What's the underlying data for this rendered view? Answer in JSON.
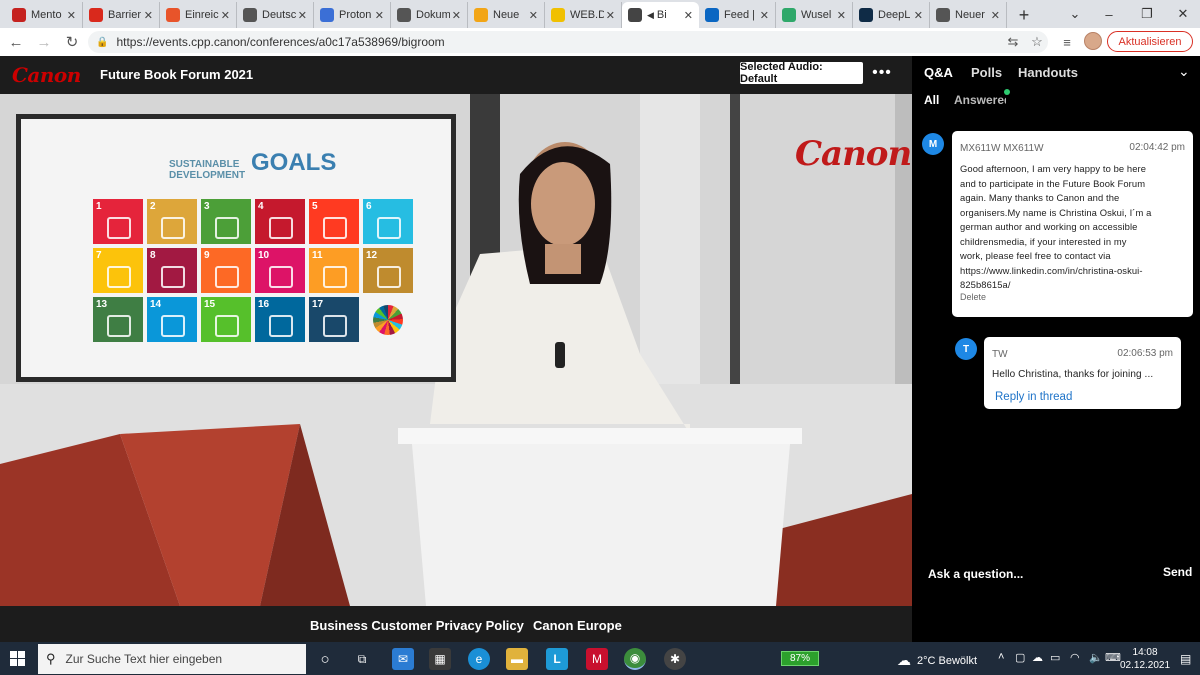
{
  "browser": {
    "tabs": [
      {
        "title": "Mento",
        "icon": "chrome-apps-icon",
        "color": "#c5221f"
      },
      {
        "title": "Barrier",
        "icon": "acrobat-icon",
        "color": "#d9291c"
      },
      {
        "title": "Einreic",
        "icon": "af-icon",
        "color": "#e8542a"
      },
      {
        "title": "Deutsc",
        "icon": "z-icon",
        "color": "#555555"
      },
      {
        "title": "Proton",
        "icon": "proton-icon",
        "color": "#3b6fd6"
      },
      {
        "title": "Dokum",
        "icon": "document-icon",
        "color": "#555555"
      },
      {
        "title": "Neue",
        "icon": "smiley-icon",
        "color": "#f2a516"
      },
      {
        "title": "WEB.D",
        "icon": "web-de-icon",
        "color": "#f0c000"
      },
      {
        "title": "Bi",
        "icon": "globe-icon",
        "color": "#444444",
        "active": true,
        "audio": "◀"
      },
      {
        "title": "Feed |",
        "icon": "linkedin-icon",
        "color": "#0a66c2"
      },
      {
        "title": "Wusel",
        "icon": "w-icon",
        "color": "#2fa86a"
      },
      {
        "title": "DeepL",
        "icon": "deepl-icon",
        "color": "#0f2b46"
      },
      {
        "title": "Neuer",
        "icon": "chrome-icon",
        "color": "#555555"
      }
    ],
    "url": "https://events.cpp.canon/conferences/a0c17a538969/bigroom",
    "update_label": "Aktualisieren"
  },
  "event": {
    "brand": "Canon",
    "title": "Future Book Forum 2021",
    "audio_label": "Selected Audio: Default",
    "more_label": "•••"
  },
  "video": {
    "heading_line1": "SUSTAINABLE",
    "heading_line2": "DEVELOPMENT",
    "heading_goals": "GOALS",
    "wall_brand": "Canon",
    "goals": [
      {
        "n": "1",
        "color": "#e5243b"
      },
      {
        "n": "2",
        "color": "#dda63a"
      },
      {
        "n": "3",
        "color": "#4c9f38"
      },
      {
        "n": "4",
        "color": "#c5192d"
      },
      {
        "n": "5",
        "color": "#ff3a21"
      },
      {
        "n": "6",
        "color": "#26bde2"
      },
      {
        "n": "7",
        "color": "#fcc30b"
      },
      {
        "n": "8",
        "color": "#a21942"
      },
      {
        "n": "9",
        "color": "#fd6925"
      },
      {
        "n": "10",
        "color": "#dd1367"
      },
      {
        "n": "11",
        "color": "#fd9d24"
      },
      {
        "n": "12",
        "color": "#bf8b2e"
      },
      {
        "n": "13",
        "color": "#3f7e44"
      },
      {
        "n": "14",
        "color": "#0a97d9"
      },
      {
        "n": "15",
        "color": "#56c02b"
      },
      {
        "n": "16",
        "color": "#00689d"
      },
      {
        "n": "17",
        "color": "#19486a"
      }
    ]
  },
  "footer": {
    "privacy": "Business Customer Privacy Policy",
    "europe": "Canon Europe"
  },
  "qa": {
    "tabs": [
      "Q&A",
      "Polls",
      "Handouts"
    ],
    "subtabs": [
      "All",
      "Answered"
    ],
    "messages": [
      {
        "avatar": "M",
        "author": "MX611W MX611W",
        "time": "02:04:42 pm",
        "lines": [
          "Good afternoon, I am very happy to be here",
          "and to participate in the Future Book Forum",
          "again. Many thanks to Canon and the",
          "organisers.My name is Christina Oskui, I´m a",
          "german author and working on accessible",
          "childrensmedia, if your interested in my",
          "work, please feel free to contact via",
          "https://www.linkedin.com/in/christina-oskui-",
          "825b8615a/"
        ],
        "delete_label": "Delete"
      },
      {
        "avatar": "T",
        "author": "TW",
        "time": "02:06:53 pm",
        "text": "Hello Christina, thanks for joining ...",
        "reply_label": "Reply in thread"
      }
    ],
    "input_placeholder": "Ask a question...",
    "send_label": "Send"
  },
  "taskbar": {
    "search_placeholder": "Zur Suche Text hier eingeben",
    "battery": "87%",
    "weather": "2°C  Bewölkt",
    "time": "14:08",
    "date": "02.12.2021"
  }
}
